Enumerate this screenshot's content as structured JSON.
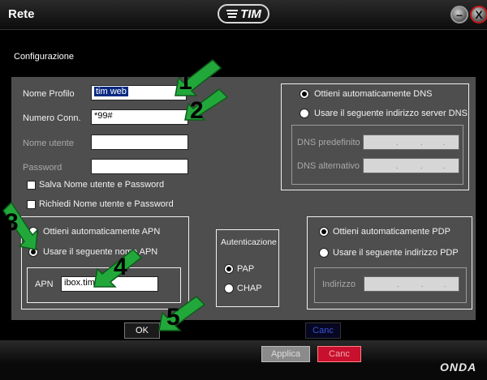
{
  "window": {
    "title": "Rete",
    "logo_text": "TIM",
    "minimize_label": "–",
    "close_label": "X"
  },
  "section_label": "Configurazione",
  "profile": {
    "name_label": "Nome Profilo",
    "name_value": "tim web",
    "number_label": "Numero Conn.",
    "number_value": "*99#",
    "user_label": "Nome utente",
    "user_value": "",
    "password_label": "Password",
    "password_value": "",
    "save_credentials_label": "Salva Nome utente e Password",
    "save_credentials_checked": false,
    "ask_credentials_label": "Richiedi Nome utente e Password",
    "ask_credentials_checked": false
  },
  "dns": {
    "auto_label": "Ottieni automaticamente DNS",
    "auto_selected": true,
    "manual_label": "Usare il seguente indirizzo server DNS",
    "manual_selected": false,
    "preferred_label": "DNS predefinito",
    "alternate_label": "DNS alternativo"
  },
  "apn": {
    "auto_label": "Ottieni automaticamente APN",
    "auto_selected": false,
    "manual_label": "Usare il seguente nome APN",
    "manual_selected": true,
    "field_label": "APN",
    "field_value": "ibox.tim.it"
  },
  "auth": {
    "title": "Autenticazione",
    "pap_label": "PAP",
    "pap_selected": true,
    "chap_label": "CHAP",
    "chap_selected": false
  },
  "pdp": {
    "auto_label": "Ottieni automaticamente PDP",
    "auto_selected": true,
    "manual_label": "Usare il seguente indirizzo PDP",
    "manual_selected": false,
    "address_label": "Indirizzo"
  },
  "buttons": {
    "ok": "OK",
    "cancel_top": "Canc",
    "apply": "Applica",
    "cancel_bottom": "Canc"
  },
  "brand": "ONDA",
  "annotations": [
    "1",
    "2",
    "3",
    "4",
    "5"
  ],
  "colors": {
    "arrow_green": "#22a83a",
    "cancel_red": "#c8102e",
    "panel_gray": "#4e4e4e"
  }
}
